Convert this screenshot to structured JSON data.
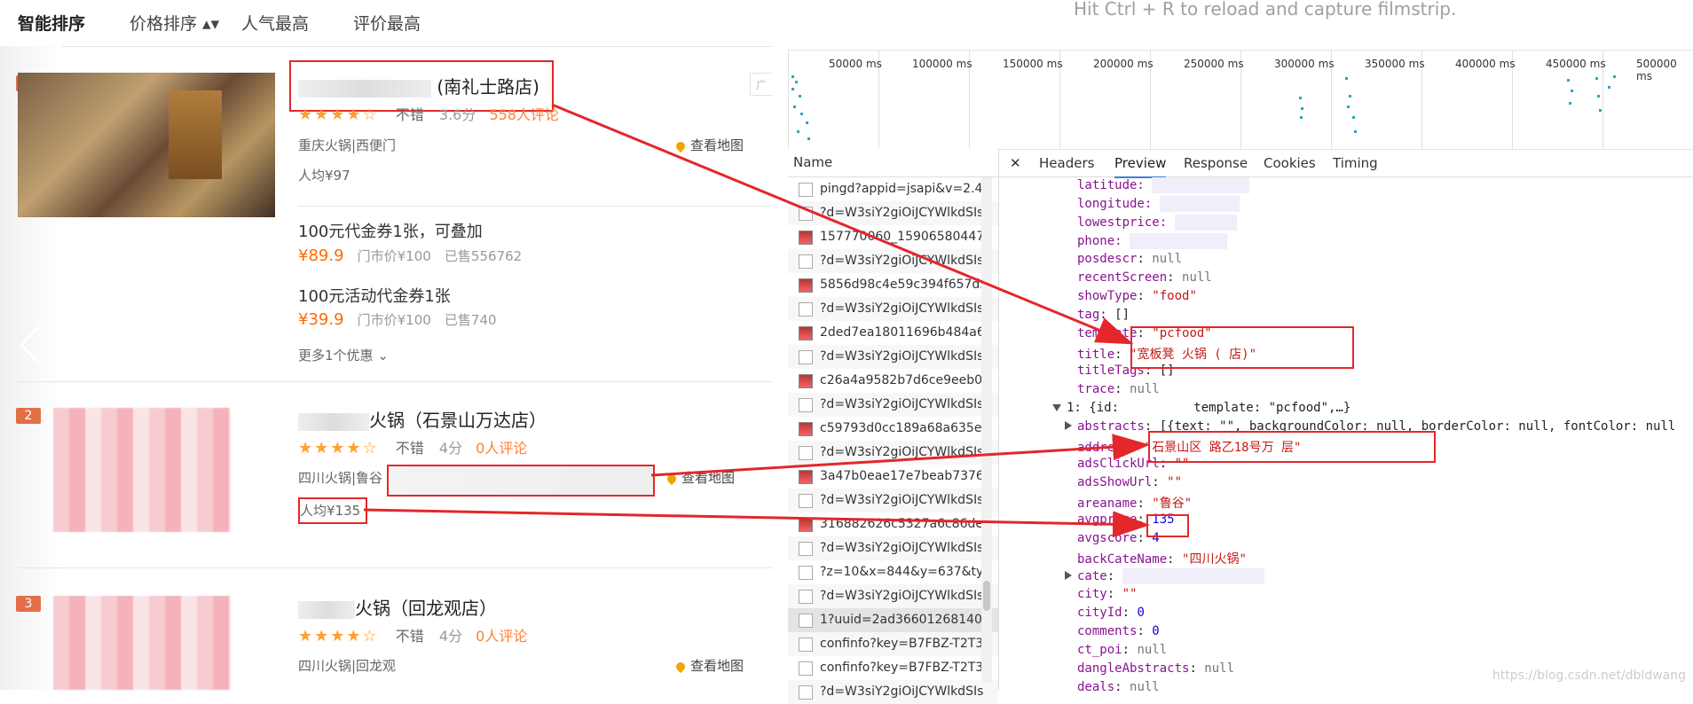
{
  "sortbar": {
    "items": [
      "智能排序",
      "价格排序 ▴▾",
      "人气最高",
      "评价最高"
    ]
  },
  "restaurants": [
    {
      "rank": "1",
      "name_suffix": "(南礼士路店)",
      "stars": "★★★★☆",
      "rating_word": "不错",
      "score": "3.6分",
      "reviews": "558人评论",
      "category": "重庆火锅|西便门",
      "map_label": "查看地图",
      "avg": "人均¥97",
      "deals": [
        {
          "title": "100元代金券1张，可叠加",
          "price": "¥89.9",
          "orig": "门市价¥100",
          "sold": "已售556762"
        },
        {
          "title": "100元活动代金券1张",
          "price": "¥39.9",
          "orig": "门市价¥100",
          "sold": "已售740"
        }
      ],
      "more": "更多1个优惠"
    },
    {
      "rank": "2",
      "name_suffix": "火锅（石景山万达店）",
      "stars": "★★★★☆",
      "rating_word": "不错",
      "score": "4分",
      "reviews": "0人评论",
      "category": "四川火锅|鲁谷",
      "map_label": "查看地图",
      "avg": "人均¥135"
    },
    {
      "rank": "3",
      "name_suffix": "火锅（回龙观店）",
      "stars": "★★★★☆",
      "rating_word": "不错",
      "score": "4分",
      "reviews": "0人评论",
      "category": "四川火锅|回龙观",
      "map_label": "查看地图"
    }
  ],
  "ad_tag": "广",
  "devtools": {
    "hint": "Hit Ctrl + R to reload and capture filmstrip.",
    "timeline": [
      "50000 ms",
      "100000 ms",
      "150000 ms",
      "200000 ms",
      "250000 ms",
      "300000 ms",
      "350000 ms",
      "400000 ms",
      "450000 ms",
      "500000 ms"
    ],
    "name_header": "Name",
    "requests": [
      "pingd?appid=jsapi&v=2.4.",
      "?d=W3siY2giOiJCYWlkdSIs",
      "157770060_159065804477",
      "?d=W3siY2giOiJCYWlkdSIs",
      "5856d98c4e59c394f657d3",
      "?d=W3siY2giOiJCYWlkdSIs",
      "2ded7ea18011696b484a68",
      "?d=W3siY2giOiJCYWlkdSIs",
      "c26a4a9582b7d6ce9eeb09",
      "?d=W3siY2giOiJCYWlkdSIs",
      "c59793d0cc189a68a635e2",
      "?d=W3siY2giOiJCYWlkdSIs",
      "3a47b0eae17e7beab73760",
      "?d=W3siY2giOiJCYWlkdSIs",
      "316882626c5327a6c86de3",
      "?d=W3siY2giOiJCYWlkdSIs",
      "?z=10&x=844&y=637&typ",
      "?d=W3siY2giOiJCYWlkdSIs",
      "1?uuid=2ad36601268140b",
      "confinfo?key=B7FBZ-T2T3J",
      "confinfo?key=B7FBZ-T2T3J",
      "?d=W3siY2giOiJCYWlkdSIs"
    ],
    "tabs": [
      "Headers",
      "Preview",
      "Response",
      "Cookies",
      "Timing"
    ],
    "close": "✕",
    "preview": {
      "l01": "latitude: ",
      "l02": "longitude: ",
      "l03": "lowestprice: ",
      "l04": "phone: ",
      "l05k": "posdescr",
      "l05v": "null",
      "l06k": "recentScreen",
      "l06v": "null",
      "l07k": "showType",
      "l07v": "\"food\"",
      "l08k": "tag",
      "l08v": "[]",
      "l09k": "template",
      "l09v": "\"pcfood\"",
      "l10k": "title",
      "l10v": "\"宽板凳 火锅 ( 店)\"",
      "l11k": "titleTags",
      "l11v": "[]",
      "l12k": "trace",
      "l12v": "null",
      "l13": "1: {id:          template: \"pcfood\",…}",
      "l14k": "abstracts",
      "l14v": "[{text: \"\", backgroundColor: null, borderColor: null, fontColor: null",
      "l15k": "address",
      "l15v": "\"石景山区 路乙18号万 层\"",
      "l16k": "adsClickUrl",
      "l16v": "\"\"",
      "l17k": "adsShowUrl",
      "l17v": "\"\"",
      "l18k": "areaname",
      "l18v": "\"鲁谷\"",
      "l19k": "avgprice",
      "l19v": "135",
      "l20k": "avgscore",
      "l20v": "4",
      "l21k": "backCateName",
      "l21v": "\"四川火锅\"",
      "l22k": "cate",
      "l22v": "",
      "l23k": "city",
      "l23v": "\"\"",
      "l24k": "cityId",
      "l24v": "0",
      "l25k": "comments",
      "l25v": "0",
      "l26k": "ct_poi",
      "l26v": "null",
      "l27k": "dangleAbstracts",
      "l27v": "null",
      "l28k": "deals",
      "l28v": "null"
    }
  },
  "watermark": "https://blog.csdn.net/dbldwang",
  "colors": {
    "highlight": "#e3272b",
    "accent": "#ff7f2f",
    "devtools_key": "#881391"
  }
}
